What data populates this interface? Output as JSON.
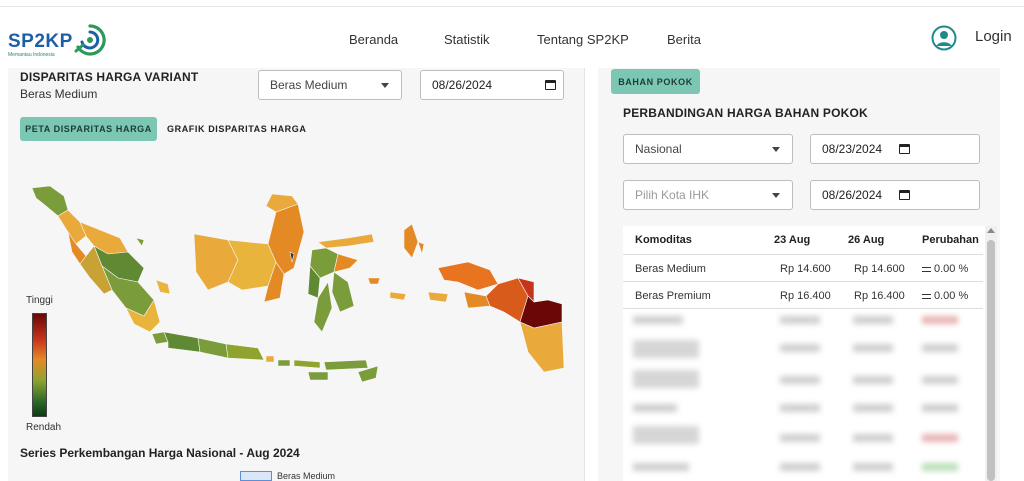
{
  "brand": {
    "name": "SP2KP",
    "tagline": "Memantau Indonesia",
    "color": "#1c5fa8",
    "accent": "#2a9a5a"
  },
  "nav": {
    "items": [
      {
        "label": "Beranda"
      },
      {
        "label": "Statistik"
      },
      {
        "label": "Tentang SP2KP"
      },
      {
        "label": "Berita"
      }
    ],
    "login_label": "Login",
    "user_icon": "user-circle-icon"
  },
  "disparity": {
    "title": "DISPARITAS HARGA VARIANT",
    "subtitle": "Beras Medium",
    "variant_select": {
      "value": "Beras Medium"
    },
    "date_input": {
      "value": "08/26/2024"
    },
    "tabs": [
      {
        "label": "PETA DISPARITAS HARGA",
        "active": true
      },
      {
        "label": "GRAFIK DISPARITAS HARGA",
        "active": false
      }
    ],
    "legend": {
      "high": "Tinggi",
      "low": "Rendah",
      "gradient": [
        "#6a0707",
        "#c7341c",
        "#e38a25",
        "#8fa32f",
        "#2f6b2a",
        "#0f3a12"
      ]
    },
    "series_title": "Series Perkembangan Harga Nasional - Aug 2024",
    "series_legend": "Beras Medium"
  },
  "comparison": {
    "badge": "BAHAN POKOK",
    "title": "PERBANDINGAN HARGA BAHAN POKOK",
    "region_select": {
      "value": "Nasional"
    },
    "date_from": {
      "value": "08/23/2024"
    },
    "city_select": {
      "placeholder": "Pilih Kota IHK"
    },
    "date_to": {
      "value": "08/26/2024"
    },
    "table": {
      "headers": [
        "Komoditas",
        "23 Aug",
        "26 Aug",
        "Perubahan"
      ],
      "rows": [
        {
          "name": "Beras Medium",
          "prev": "Rp 14.600",
          "curr": "Rp 14.600",
          "change": "0.00 %"
        },
        {
          "name": "Beras Premium",
          "prev": "Rp 16.400",
          "curr": "Rp 16.400",
          "change": "0.00 %"
        }
      ]
    }
  },
  "colors": {
    "teal": "#7cc6b4",
    "panel_bg": "#f6f6f6"
  }
}
